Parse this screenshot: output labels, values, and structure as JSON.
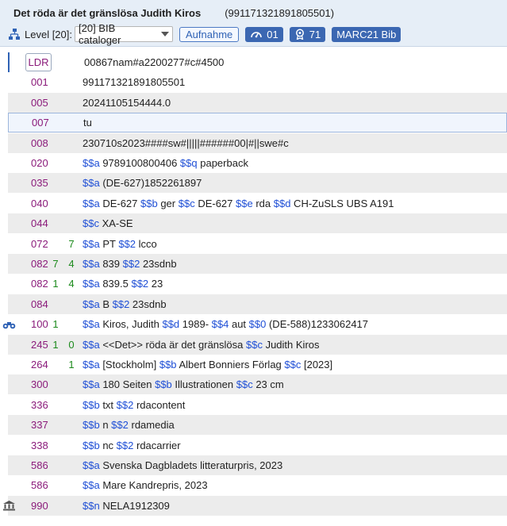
{
  "header": {
    "title": "Det röda är det gränslösa Judith Kiros",
    "record_id": "(991171321891805501)",
    "level_label": "Level [20]:",
    "level_select": "[20] BIB cataloger",
    "aufnahme_label": "Aufnahme",
    "gauge_count": "01",
    "badge_count": "71",
    "format_label": "MARC21 Bib"
  },
  "colors": {
    "header_bg": "#e6eef7",
    "tag": "#8a1a7a",
    "indicator": "#1c8a1c",
    "subfield_code": "#1f4fd6",
    "button_blue": "#3b67b2"
  },
  "rows": [
    {
      "tag": "LDR",
      "ind1": "",
      "ind2": "",
      "parts": [
        {
          "t": "00867nam#a2200277#c#4500",
          "c": false
        }
      ]
    },
    {
      "tag": "001",
      "ind1": "",
      "ind2": "",
      "parts": [
        {
          "t": "991171321891805501",
          "c": false
        }
      ]
    },
    {
      "tag": "005",
      "ind1": "",
      "ind2": "",
      "parts": [
        {
          "t": "20241105154444.0",
          "c": false
        }
      ]
    },
    {
      "tag": "007",
      "ind1": "",
      "ind2": "",
      "parts": [
        {
          "t": "tu",
          "c": false
        }
      ]
    },
    {
      "tag": "008",
      "ind1": "",
      "ind2": "",
      "parts": [
        {
          "t": "230710s2023####sw#|||||######00|#||swe#c",
          "c": false
        }
      ]
    },
    {
      "tag": "020",
      "ind1": "",
      "ind2": "",
      "parts": [
        {
          "t": "$$a",
          "c": true
        },
        {
          "t": " 9789100800406 ",
          "c": false
        },
        {
          "t": "$$q",
          "c": true
        },
        {
          "t": " paperback",
          "c": false
        }
      ]
    },
    {
      "tag": "035",
      "ind1": "",
      "ind2": "",
      "parts": [
        {
          "t": "$$a",
          "c": true
        },
        {
          "t": " (DE-627)1852261897",
          "c": false
        }
      ]
    },
    {
      "tag": "040",
      "ind1": "",
      "ind2": "",
      "parts": [
        {
          "t": "$$a",
          "c": true
        },
        {
          "t": " DE-627 ",
          "c": false
        },
        {
          "t": "$$b",
          "c": true
        },
        {
          "t": " ger ",
          "c": false
        },
        {
          "t": "$$c",
          "c": true
        },
        {
          "t": " DE-627 ",
          "c": false
        },
        {
          "t": "$$e",
          "c": true
        },
        {
          "t": " rda ",
          "c": false
        },
        {
          "t": "$$d",
          "c": true
        },
        {
          "t": " CH-ZuSLS UBS A191",
          "c": false
        }
      ]
    },
    {
      "tag": "044",
      "ind1": "",
      "ind2": "",
      "parts": [
        {
          "t": "$$c",
          "c": true
        },
        {
          "t": " XA-SE",
          "c": false
        }
      ]
    },
    {
      "tag": "072",
      "ind1": "",
      "ind2": "7",
      "parts": [
        {
          "t": "$$a",
          "c": true
        },
        {
          "t": " PT ",
          "c": false
        },
        {
          "t": "$$2",
          "c": true
        },
        {
          "t": " lcco",
          "c": false
        }
      ]
    },
    {
      "tag": "082",
      "ind1": "7",
      "ind2": "4",
      "parts": [
        {
          "t": "$$a",
          "c": true
        },
        {
          "t": " 839 ",
          "c": false
        },
        {
          "t": "$$2",
          "c": true
        },
        {
          "t": " 23sdnb",
          "c": false
        }
      ]
    },
    {
      "tag": "082",
      "ind1": "1",
      "ind2": "4",
      "parts": [
        {
          "t": "$$a",
          "c": true
        },
        {
          "t": " 839.5 ",
          "c": false
        },
        {
          "t": "$$2",
          "c": true
        },
        {
          "t": " 23",
          "c": false
        }
      ]
    },
    {
      "tag": "084",
      "ind1": "",
      "ind2": "",
      "parts": [
        {
          "t": "$$a",
          "c": true
        },
        {
          "t": " B ",
          "c": false
        },
        {
          "t": "$$2",
          "c": true
        },
        {
          "t": " 23sdnb",
          "c": false
        }
      ]
    },
    {
      "tag": "100",
      "ind1": "1",
      "ind2": "",
      "icon": "binoculars-icon",
      "parts": [
        {
          "t": "$$a",
          "c": true
        },
        {
          "t": " Kiros, Judith ",
          "c": false
        },
        {
          "t": "$$d",
          "c": true
        },
        {
          "t": " 1989- ",
          "c": false
        },
        {
          "t": "$$4",
          "c": true
        },
        {
          "t": " aut ",
          "c": false
        },
        {
          "t": "$$0",
          "c": true
        },
        {
          "t": " (DE-588)1233062417",
          "c": false
        }
      ]
    },
    {
      "tag": "245",
      "ind1": "1",
      "ind2": "0",
      "parts": [
        {
          "t": "$$a",
          "c": true
        },
        {
          "t": " <<Det>> röda är det gränslösa ",
          "c": false
        },
        {
          "t": "$$c",
          "c": true
        },
        {
          "t": " Judith Kiros",
          "c": false
        }
      ]
    },
    {
      "tag": "264",
      "ind1": "",
      "ind2": "1",
      "parts": [
        {
          "t": "$$a",
          "c": true
        },
        {
          "t": " [Stockholm] ",
          "c": false
        },
        {
          "t": "$$b",
          "c": true
        },
        {
          "t": " Albert Bonniers Förlag ",
          "c": false
        },
        {
          "t": "$$c",
          "c": true
        },
        {
          "t": " [2023]",
          "c": false
        }
      ]
    },
    {
      "tag": "300",
      "ind1": "",
      "ind2": "",
      "parts": [
        {
          "t": "$$a",
          "c": true
        },
        {
          "t": " 180 Seiten ",
          "c": false
        },
        {
          "t": "$$b",
          "c": true
        },
        {
          "t": " Illustrationen ",
          "c": false
        },
        {
          "t": "$$c",
          "c": true
        },
        {
          "t": " 23 cm",
          "c": false
        }
      ]
    },
    {
      "tag": "336",
      "ind1": "",
      "ind2": "",
      "parts": [
        {
          "t": "$$b",
          "c": true
        },
        {
          "t": " txt ",
          "c": false
        },
        {
          "t": "$$2",
          "c": true
        },
        {
          "t": " rdacontent",
          "c": false
        }
      ]
    },
    {
      "tag": "337",
      "ind1": "",
      "ind2": "",
      "parts": [
        {
          "t": "$$b",
          "c": true
        },
        {
          "t": " n ",
          "c": false
        },
        {
          "t": "$$2",
          "c": true
        },
        {
          "t": " rdamedia",
          "c": false
        }
      ]
    },
    {
      "tag": "338",
      "ind1": "",
      "ind2": "",
      "parts": [
        {
          "t": "$$b",
          "c": true
        },
        {
          "t": " nc ",
          "c": false
        },
        {
          "t": "$$2",
          "c": true
        },
        {
          "t": " rdacarrier",
          "c": false
        }
      ]
    },
    {
      "tag": "586",
      "ind1": "",
      "ind2": "",
      "parts": [
        {
          "t": "$$a",
          "c": true
        },
        {
          "t": " Svenska Dagbladets litteraturpris, 2023",
          "c": false
        }
      ]
    },
    {
      "tag": "586",
      "ind1": "",
      "ind2": "",
      "parts": [
        {
          "t": "$$a",
          "c": true
        },
        {
          "t": " Mare Kandrepris, 2023",
          "c": false
        }
      ]
    },
    {
      "tag": "990",
      "ind1": "",
      "ind2": "",
      "icon": "institution-icon",
      "parts": [
        {
          "t": "$$n",
          "c": true
        },
        {
          "t": " NELA1912309",
          "c": false
        }
      ]
    }
  ]
}
